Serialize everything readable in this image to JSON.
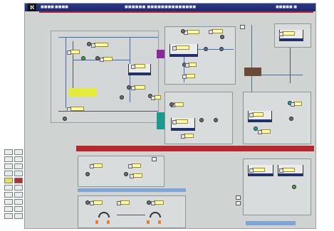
{
  "titlebar": {
    "logo": "ℵ",
    "menu": [
      "■■■■",
      "■■■■"
    ],
    "title": "■■■■■■ ■■■■■■■■■■■■■■",
    "right": "■■■■■ ■"
  },
  "colors": {
    "title_bg": "#1c2a6e",
    "alarm_bar": "#b7272b",
    "pipe": "#3b6fb0",
    "label_fill": "#ffffb0",
    "yellow_block": "#e4eb3a",
    "purple_block": "#8a2a9a",
    "teal_block": "#1a9a8e",
    "brown_block": "#6a4a34",
    "tank_fill": "#1b2f80"
  },
  "icons": [
    "logo-icon",
    "pump-icon",
    "tank-icon",
    "valve-icon",
    "gauge-icon"
  ]
}
